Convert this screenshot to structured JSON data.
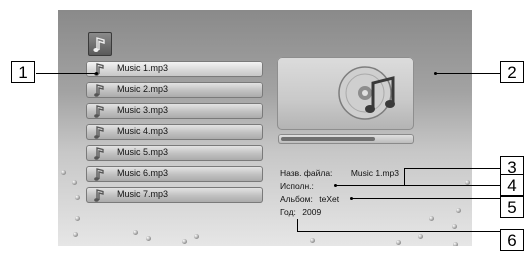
{
  "player": {
    "app_icon": "music-note-icon",
    "tracks": [
      {
        "label": "Music 1.mp3",
        "selected": true
      },
      {
        "label": "Music 2.mp3",
        "selected": false
      },
      {
        "label": "Music 3.mp3",
        "selected": false
      },
      {
        "label": "Music 4.mp3",
        "selected": false
      },
      {
        "label": "Music 5.mp3",
        "selected": false
      },
      {
        "label": "Music 6.mp3",
        "selected": false
      },
      {
        "label": "Music 7.mp3",
        "selected": false
      }
    ],
    "cover_icon": "cd-music-icon",
    "progress": 0.72,
    "info": {
      "filename_label": "Назв. файла:",
      "filename_value": "Music 1.mp3",
      "artist_label": "Исполн.:",
      "album_label": "Альбом:",
      "album_value": "teXet",
      "year_label": "Год:",
      "year_value": "2009"
    }
  },
  "callouts": [
    "1",
    "2",
    "3",
    "4",
    "5",
    "6"
  ]
}
